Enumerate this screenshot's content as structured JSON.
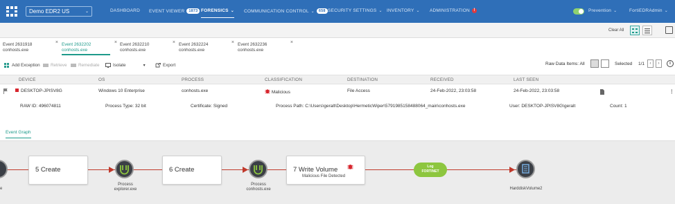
{
  "org_selector": "Demo EDR2 US",
  "nav": {
    "dashboard": "DASHBOARD",
    "event_viewer": "EVENT VIEWER",
    "event_viewer_count": "1873",
    "forensics": "FORENSICS",
    "communication_control": "COMMUNICATION CONTROL",
    "communication_control_count": "658",
    "security_settings": "SECURITY SETTINGS",
    "inventory": "INVENTORY",
    "administration": "ADMINISTRATION",
    "administration_alert": "!",
    "prevention": "Prevention",
    "user": "FortiEDRAdmin"
  },
  "strip": {
    "clear_all": "Clear All"
  },
  "tabs": [
    {
      "title": "Event 2631918",
      "process": "conhosts.exe",
      "close": "×"
    },
    {
      "title": "Event 2632202",
      "process": "conhosts.exe",
      "close": "×"
    },
    {
      "title": "Event 2632210",
      "process": "conhosts.exe",
      "close": "×"
    },
    {
      "title": "Event 2632224",
      "process": "conhosts.exe",
      "close": "×"
    },
    {
      "title": "Event 2632236",
      "process": "conhosts.exe",
      "close": "×"
    }
  ],
  "actions": {
    "add_exception": "Add Exception",
    "retrieve": "Retrieve",
    "remediate": "Remediate",
    "isolate": "Isolate",
    "export": "Export",
    "raw_data_items": "Raw Data Items: All",
    "selected": "Selected",
    "pages": "1/1",
    "prev": "‹",
    "next": "›",
    "info": "i"
  },
  "table": {
    "headers": [
      "DEVICE",
      "OS",
      "PROCESS",
      "CLASSIFICATION",
      "DESTINATION",
      "RECEIVED",
      "LAST SEEN"
    ],
    "row": {
      "device": "DESKTOP-JPISV8G",
      "os": "Windows 10 Enterprise",
      "process": "conhosts.exe",
      "classification": "Malicious",
      "destination": "File Access",
      "received": "24-Feb-2022, 23:03:58",
      "last_seen": "24-Feb-2022, 23:03:58",
      "more": "⋮"
    },
    "details": {
      "raw_id": "RAW ID: 496074811",
      "process_type": "Process Type: 32 bit",
      "certificate": "Certificate: Signed",
      "process_path": "Process Path: C:\\Users\\geralt\\Desktop\\HermeticWiper\\5791985158488064_main\\conhosts.exe",
      "user": "User: DESKTOP-JPISV8G\\geralt",
      "count": "Count: 1"
    }
  },
  "graph": {
    "tab_label": "Event Graph",
    "left_label": "e",
    "box1": "5 Create",
    "node1_label_a": "Process",
    "node1_label_b": "explorer.exe",
    "box2": "6 Create",
    "node2_label_a": "Process",
    "node2_label_b": "conhosts.exe",
    "box3": "7 Write Volume",
    "box3_sub": "Malicious File Detected",
    "log_label": "Log",
    "log_brand": "FORTINET",
    "target_label": "HarddiskVolume2"
  },
  "colors": {
    "nav_bg": "#2f6fb8",
    "accent": "#1d9a8a",
    "malicious": "#d7262e",
    "edge": "#c0392b",
    "log_green": "#8dc63f"
  }
}
